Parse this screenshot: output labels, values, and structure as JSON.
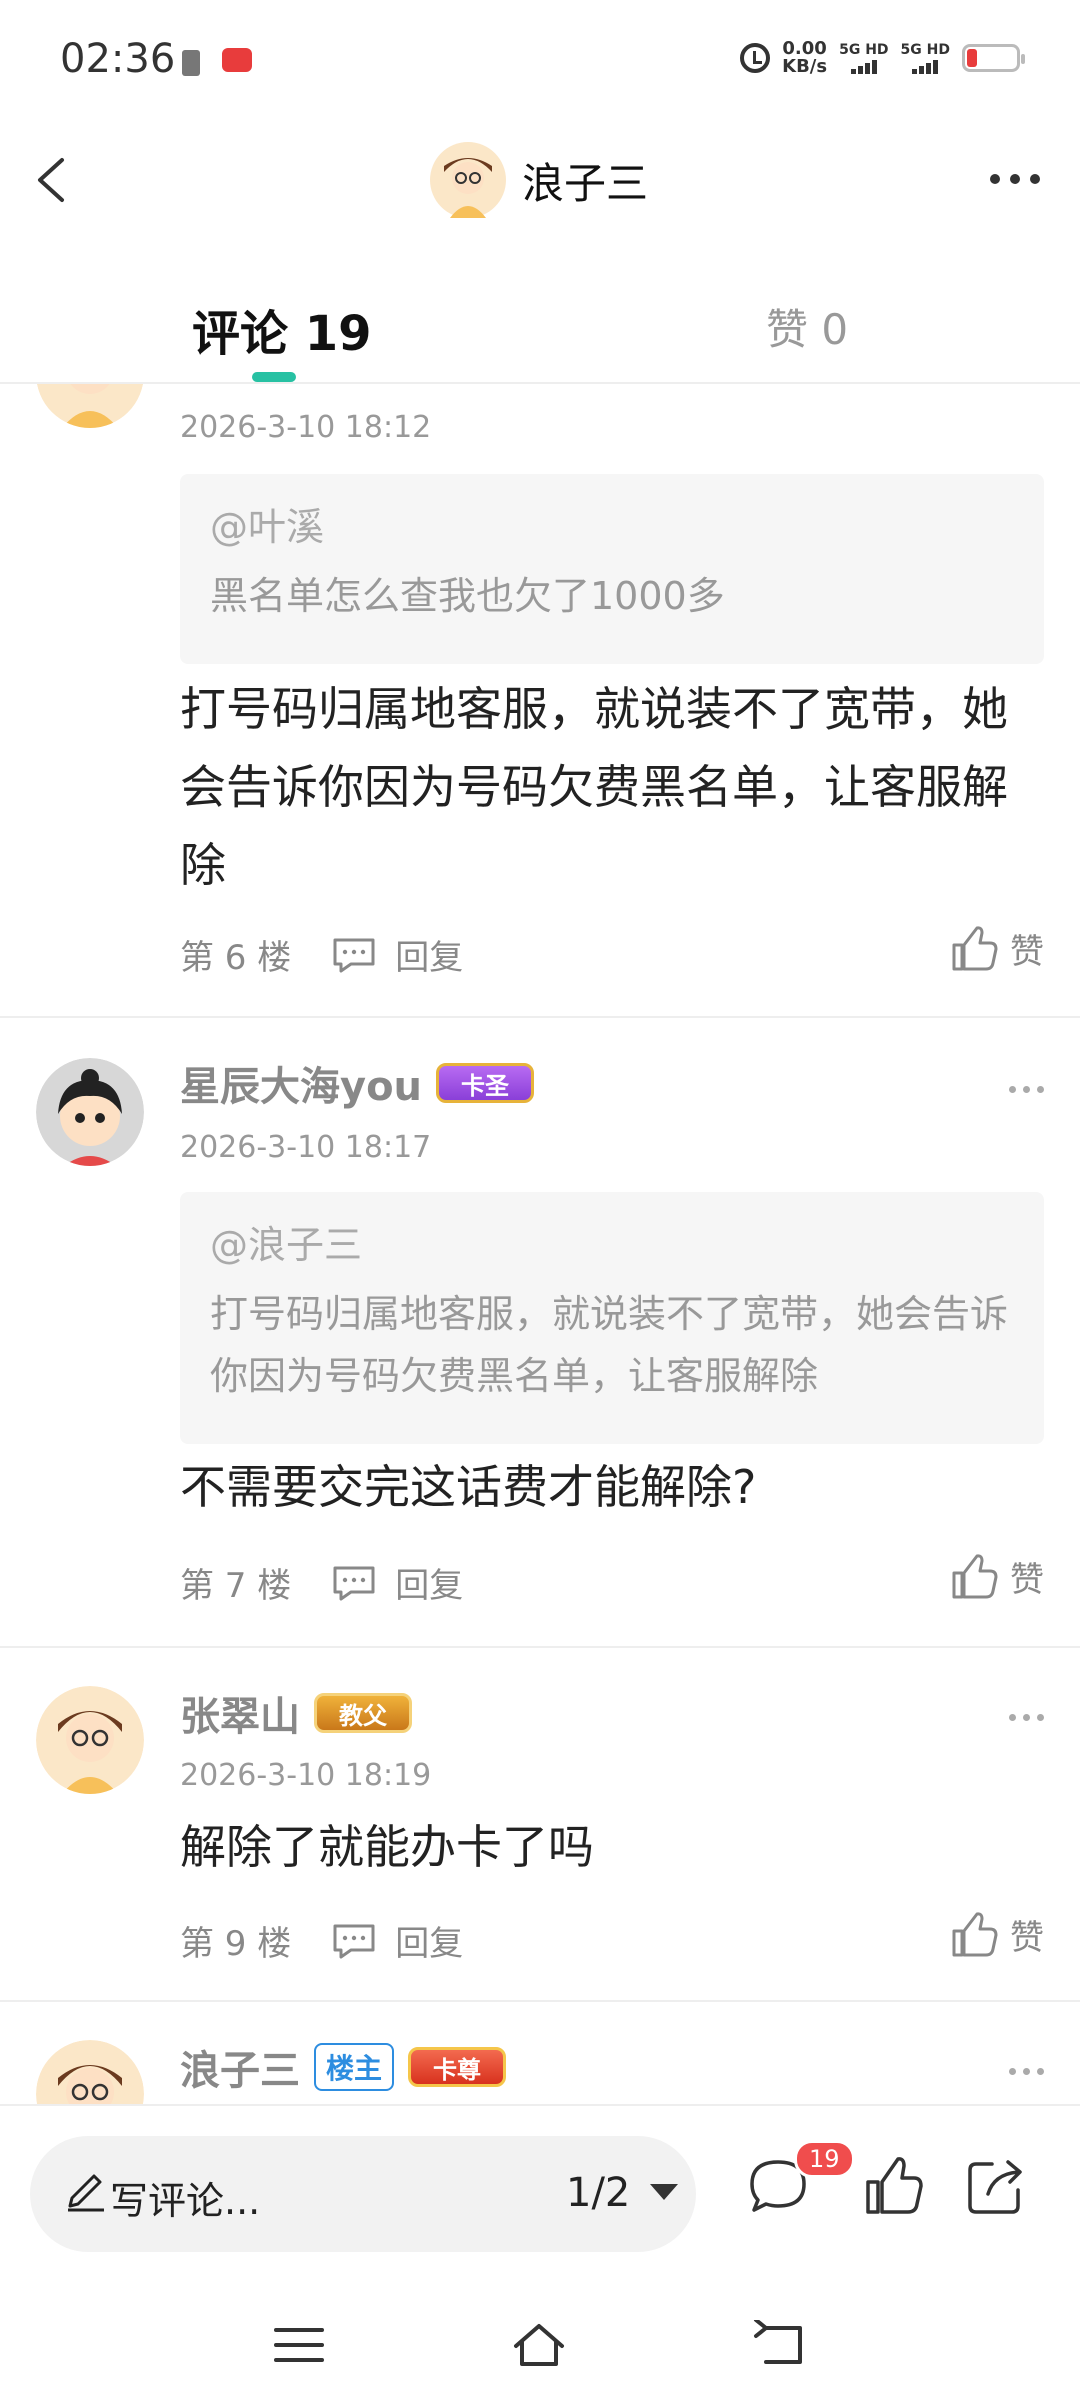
{
  "status_bar": {
    "time": "02:36",
    "net_speed_value": "0.00",
    "net_speed_unit": "KB/s",
    "sig1_label": "5G HD",
    "sig2_label": "5G HD"
  },
  "header": {
    "name": "浪子三"
  },
  "tabs": {
    "comments_label": "评论 19",
    "likes_label": "赞 0"
  },
  "comments": [
    {
      "timestamp": "2026-3-10 18:12",
      "quote_at": "@叶溪",
      "quote_text": "黑名单怎么查我也欠了1000多",
      "text": "打号码归属地客服，就说装不了宽带，她会告诉你因为号码欠费黑名单，让客服解除",
      "floor": "第 6 楼",
      "reply_label": "回复",
      "like_label": "赞"
    },
    {
      "name": "星辰大海you",
      "medal": "卡圣",
      "timestamp": "2026-3-10 18:17",
      "quote_at": "@浪子三",
      "quote_text": "打号码归属地客服，就说装不了宽带，她会告诉你因为号码欠费黑名单，让客服解除",
      "text": "不需要交完这话费才能解除?",
      "floor": "第 7 楼",
      "reply_label": "回复",
      "like_label": "赞"
    },
    {
      "name": "张翠山",
      "medal": "教父",
      "timestamp": "2026-3-10 18:19",
      "text": "解除了就能办卡了吗",
      "floor": "第 9 楼",
      "reply_label": "回复",
      "like_label": "赞"
    },
    {
      "name": "浪子三",
      "host_badge": "楼主",
      "medal": "卡尊"
    }
  ],
  "bottom_bar": {
    "input_placeholder": "写评论...",
    "pager": "1/2",
    "comment_count": "19"
  },
  "colors": {
    "accent": "#27c1a3",
    "badge_red": "#f04d4d",
    "host_blue": "#2d8de0"
  }
}
